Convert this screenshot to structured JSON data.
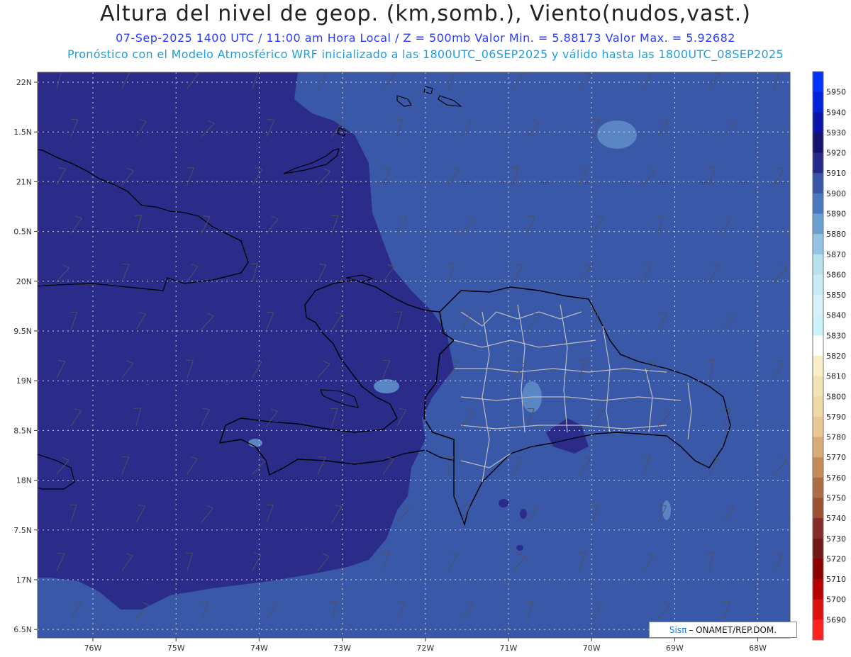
{
  "header": {
    "title": "Altura del nivel de geop. (km,somb.), Viento(nudos,vast.)",
    "subtitle_line1": "07-Sep-2025  1400 UTC / 11:00 am Hora Local / Z = 500mb    Valor Min. = 5.88173  Valor Max. = 5.92682",
    "subtitle_line2": "Pronóstico con el Modelo Atmosférico WRF inicializado a las 1800UTC_06SEP2025 y válido hasta las  1800UTC_08SEP2025"
  },
  "axes": {
    "lat_labels": [
      "22N",
      "1.5N",
      "21N",
      "0.5N",
      "20N",
      "9.5N",
      "19N",
      "8.5N",
      "18N",
      "7.5N",
      "17N",
      "6.5N"
    ],
    "lon_labels": [
      "76W",
      "75W",
      "74W",
      "73W",
      "72W",
      "71W",
      "70W",
      "69W",
      "68W"
    ]
  },
  "colorbar": {
    "levels": [
      "5950",
      "5940",
      "5930",
      "5920",
      "5910",
      "5900",
      "5890",
      "5880",
      "5870",
      "5860",
      "5850",
      "5840",
      "5830",
      "5820",
      "5810",
      "5800",
      "5790",
      "5780",
      "5770",
      "5760",
      "5750",
      "5740",
      "5730",
      "5720",
      "5710",
      "5700",
      "5690"
    ],
    "colors": [
      "#0033ff",
      "#0022dd",
      "#0a14a8",
      "#141470",
      "#262a8a",
      "#3a55a8",
      "#4a78bf",
      "#6a9fd0",
      "#94c2e2",
      "#b8e0ee",
      "#c8ecf4",
      "#d6f2f8",
      "#ccf4f8",
      "#ffffff",
      "#f8efc8",
      "#f3e3b4",
      "#efd9a6",
      "#e8c794",
      "#d7ac78",
      "#c48b58",
      "#ac6d46",
      "#9c5034",
      "#862a2a",
      "#751818",
      "#8c0000",
      "#b80000",
      "#e01010",
      "#ff2020"
    ]
  },
  "map_colors": {
    "west_field": "#2b2c8a",
    "east_field": "#3a58a8",
    "patch_light": "#5a86c4",
    "coast": "#000000",
    "provinces": "#bdbdbd"
  },
  "credit": {
    "brand": "Sisπ",
    "text": "– ONAMET/REP.DOM."
  }
}
